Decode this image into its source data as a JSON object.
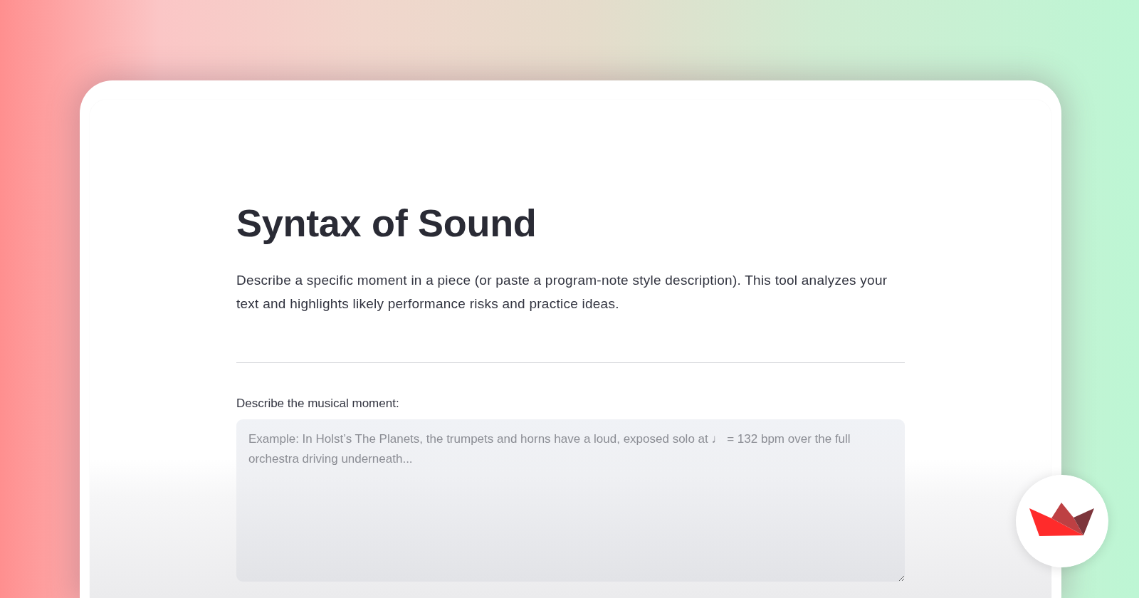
{
  "page": {
    "title": "Syntax of Sound",
    "description": "Describe a specific moment in a piece (or paste a program-note style description). This tool analyzes your text and highlights likely performance risks and practice ideas."
  },
  "input": {
    "label": "Describe the musical moment:",
    "placeholder": "Example: In Holst’s The Planets, the trumpets and horns have a loud, exposed solo at ♩ = 132 bpm over the full orchestra driving underneath..."
  }
}
